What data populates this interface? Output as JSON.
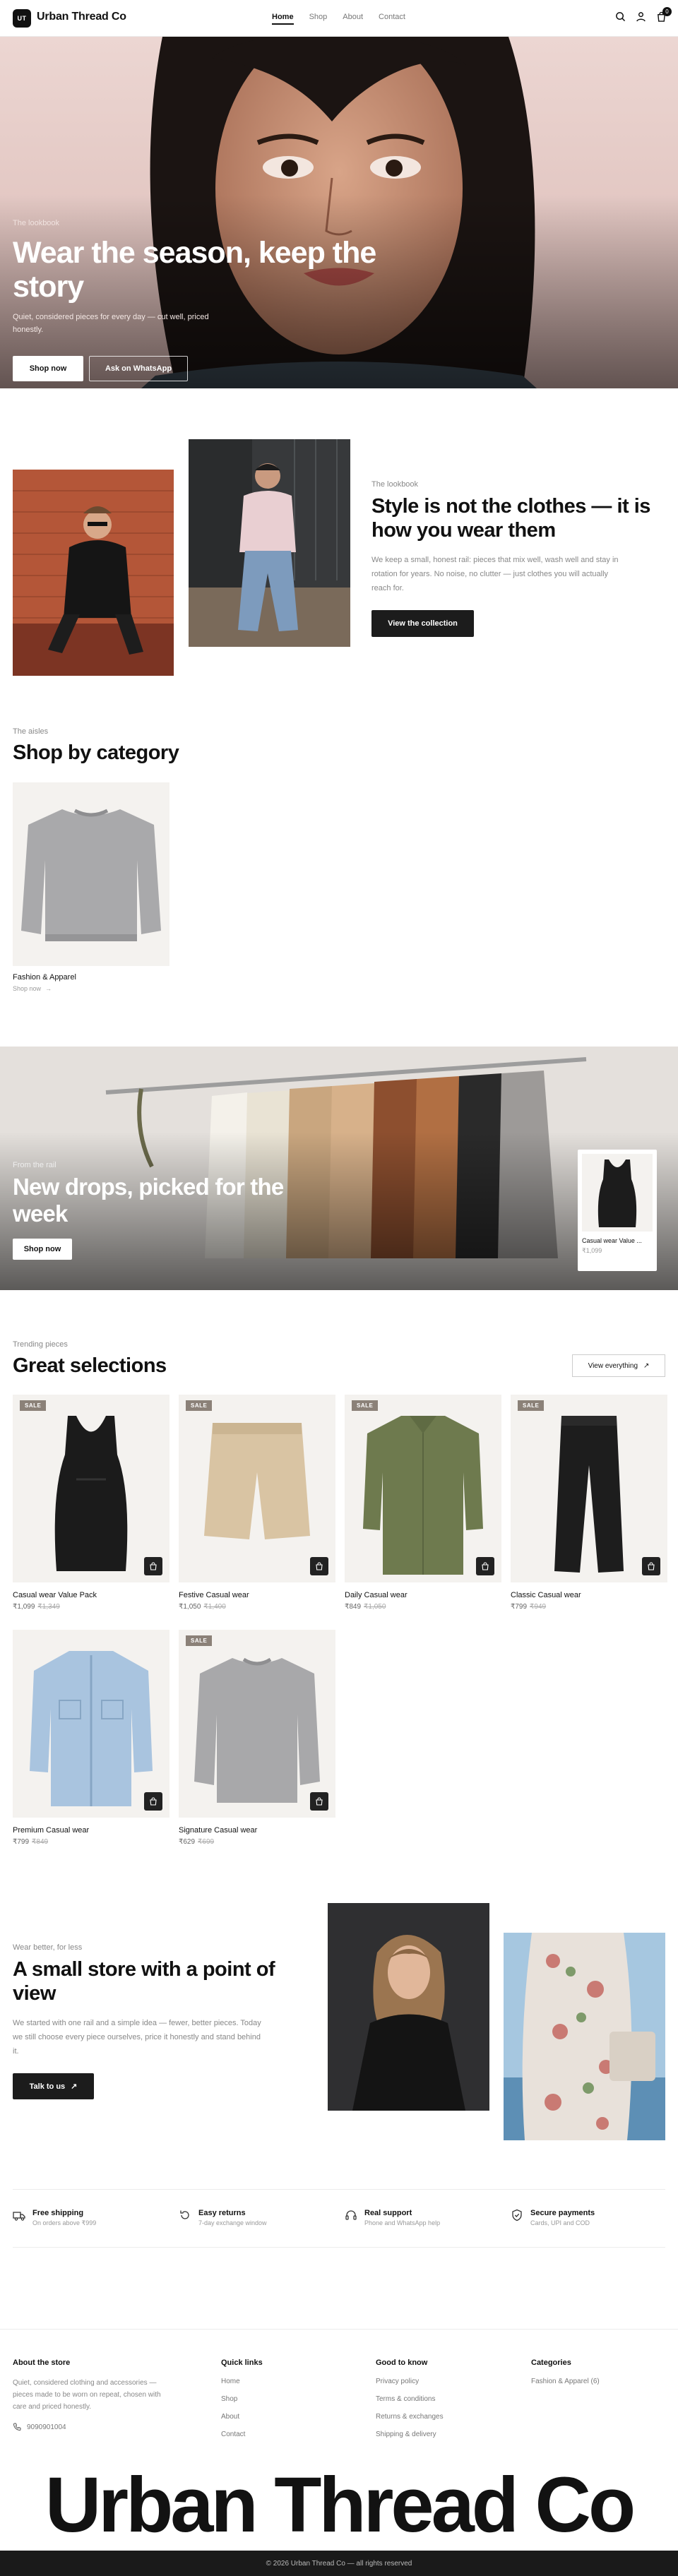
{
  "header": {
    "logo_mark": "UT",
    "brand": "Urban Thread Co",
    "nav": [
      "Home",
      "Shop",
      "About",
      "Contact"
    ],
    "cart_count": "0"
  },
  "hero": {
    "eyebrow": "The lookbook",
    "title": "Wear the season, keep the story",
    "subtitle": "Quiet, considered pieces for every day — cut well, priced honestly.",
    "primary_cta": "Shop now",
    "secondary_cta": "Ask on WhatsApp"
  },
  "lookbook": {
    "eyebrow": "The lookbook",
    "title": "Style is not the clothes — it is how you wear them",
    "body": "We keep a small, honest rail: pieces that mix well, wash well and stay in rotation for years. No noise, no clutter — just clothes you will actually reach for.",
    "cta": "View the collection"
  },
  "categories": {
    "eyebrow": "The aisles",
    "title": "Shop by category",
    "items": [
      {
        "name": "Fashion & Apparel",
        "link": "Shop now"
      }
    ]
  },
  "promo": {
    "eyebrow": "From the rail",
    "title": "New drops, picked for the week",
    "cta": "Shop now",
    "mini_product": {
      "name": "Casual wear Value ...",
      "price": "₹1,099"
    }
  },
  "selections": {
    "eyebrow": "Trending pieces",
    "title": "Great selections",
    "view_all": "View everything",
    "sale_label": "SALE",
    "products": [
      {
        "name": "Casual wear Value Pack",
        "price": "₹1,099",
        "was": "₹1,349",
        "sale": true,
        "img": "tank"
      },
      {
        "name": "Festive Casual wear",
        "price": "₹1,050",
        "was": "₹1,400",
        "sale": true,
        "img": "shorts"
      },
      {
        "name": "Daily Casual wear",
        "price": "₹849",
        "was": "₹1,050",
        "sale": true,
        "img": "shirt"
      },
      {
        "name": "Classic Casual wear",
        "price": "₹799",
        "was": "₹949",
        "sale": true,
        "img": "pants"
      },
      {
        "name": "Premium Casual wear",
        "price": "₹799",
        "was": "₹849",
        "sale": false,
        "img": "jacket"
      },
      {
        "name": "Signature Casual wear",
        "price": "₹629",
        "was": "₹699",
        "sale": true,
        "img": "sweater"
      }
    ]
  },
  "about": {
    "eyebrow": "Wear better, for less",
    "title": "A small store with a point of view",
    "body": "We started with one rail and a simple idea — fewer, better pieces. Today we still choose every piece ourselves, price it honestly and stand behind it.",
    "cta": "Talk to us"
  },
  "features": [
    {
      "icon": "truck-icon",
      "title": "Free shipping",
      "sub": "On orders above ₹999"
    },
    {
      "icon": "return-icon",
      "title": "Easy returns",
      "sub": "7-day exchange window"
    },
    {
      "icon": "headset-icon",
      "title": "Real support",
      "sub": "Phone and WhatsApp help"
    },
    {
      "icon": "shield-icon",
      "title": "Secure payments",
      "sub": "Cards, UPI and COD"
    }
  ],
  "footer": {
    "about_title": "About the store",
    "about_body": "Quiet, considered clothing and accessories — pieces made to be worn on repeat, chosen with care and priced honestly.",
    "phone": "9090901004",
    "quick_title": "Quick links",
    "quick_links": [
      "Home",
      "Shop",
      "About",
      "Contact"
    ],
    "good_title": "Good to know",
    "good_links": [
      "Privacy policy",
      "Terms & conditions",
      "Returns & exchanges",
      "Shipping & delivery"
    ],
    "cat_title": "Categories",
    "cat_links": [
      "Fashion & Apparel (6)"
    ],
    "big_brand": "Urban Thread Co",
    "copyright": "© 2026 Urban Thread Co — all rights reserved"
  }
}
